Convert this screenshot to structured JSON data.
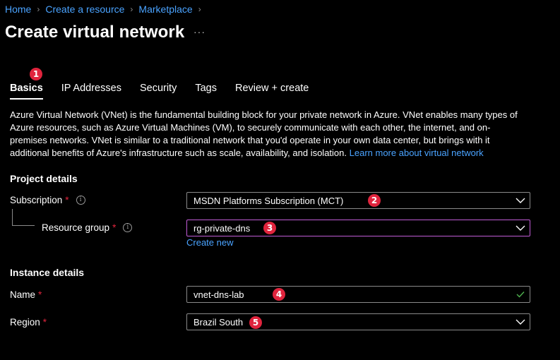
{
  "breadcrumb": [
    {
      "label": "Home"
    },
    {
      "label": "Create a resource"
    },
    {
      "label": "Marketplace"
    }
  ],
  "page_title": "Create virtual network",
  "more_icon": "ellipsis-icon",
  "tabs": [
    {
      "label": "Basics",
      "active": true
    },
    {
      "label": "IP Addresses"
    },
    {
      "label": "Security"
    },
    {
      "label": "Tags"
    },
    {
      "label": "Review + create"
    }
  ],
  "description": {
    "text": "Azure Virtual Network (VNet) is the fundamental building block for your private network in Azure. VNet enables many types of Azure resources, such as Azure Virtual Machines (VM), to securely communicate with each other, the internet, and on-premises networks. VNet is similar to a traditional network that you'd operate in your own data center, but brings with it additional benefits of Azure's infrastructure such as scale, availability, and isolation.",
    "link": "Learn more about virtual network"
  },
  "project_details": {
    "title": "Project details",
    "subscription": {
      "label": "Subscription",
      "required": "*",
      "value": "MSDN Platforms Subscription (MCT)"
    },
    "resource_group": {
      "label": "Resource group",
      "required": "*",
      "value": "rg-private-dns",
      "create_new": "Create new"
    }
  },
  "instance_details": {
    "title": "Instance details",
    "name": {
      "label": "Name",
      "required": "*",
      "value": "vnet-dns-lab"
    },
    "region": {
      "label": "Region",
      "required": "*",
      "value": "Brazil South"
    }
  },
  "annotations": [
    "1",
    "2",
    "3",
    "4",
    "5"
  ],
  "colors": {
    "background": "#000000",
    "link": "#4aa3ff",
    "required": "#e0243d",
    "badge": "#e0243d",
    "focus_border": "#c15cd6",
    "valid_check": "#4fb34f"
  }
}
